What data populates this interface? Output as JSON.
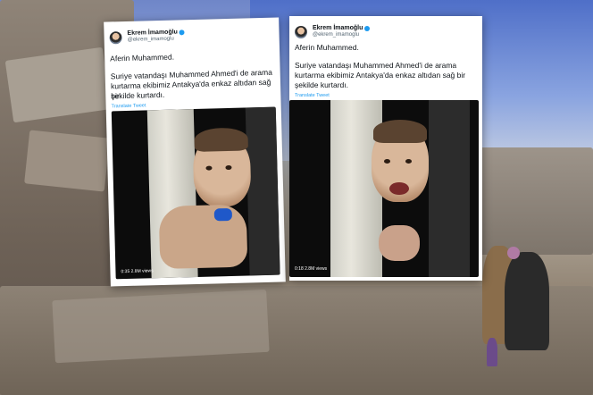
{
  "tweets": [
    {
      "author": "Ekrem İmamoğlu",
      "handle": "@ekrem_imamoglu",
      "line1": "Aferin Muhammed.",
      "line2a": "Suriye vatandaşı Muhammed Ahmed'i de arama",
      "line2b": "kurtarma ekibimiz Antakya'da enkaz altıdan sağ bir",
      "line2c": "şekilde kurtardı.",
      "translate": "Translate Tweet",
      "video_time": "0:35",
      "video_views": "2.8M views"
    },
    {
      "author": "Ekrem İmamoğlu",
      "handle": "@ekrem_imamoglu",
      "line1": "Aferin Muhammed.",
      "line2a": "Suriye vatandaşı Muhammed Ahmed'i de arama",
      "line2b": "kurtarma ekibimiz Antakya'da enkaz altıdan sağ bir",
      "line2c": "şekilde kurtardı.",
      "translate": "Translate Tweet",
      "video_time": "0:18",
      "video_views": "2.8M views"
    }
  ],
  "icons": {
    "verified": "verified-badge-icon",
    "avatar": "profile-avatar"
  },
  "colors": {
    "accent": "#1d9bf0",
    "text": "#0f1419",
    "muted": "#536471"
  }
}
